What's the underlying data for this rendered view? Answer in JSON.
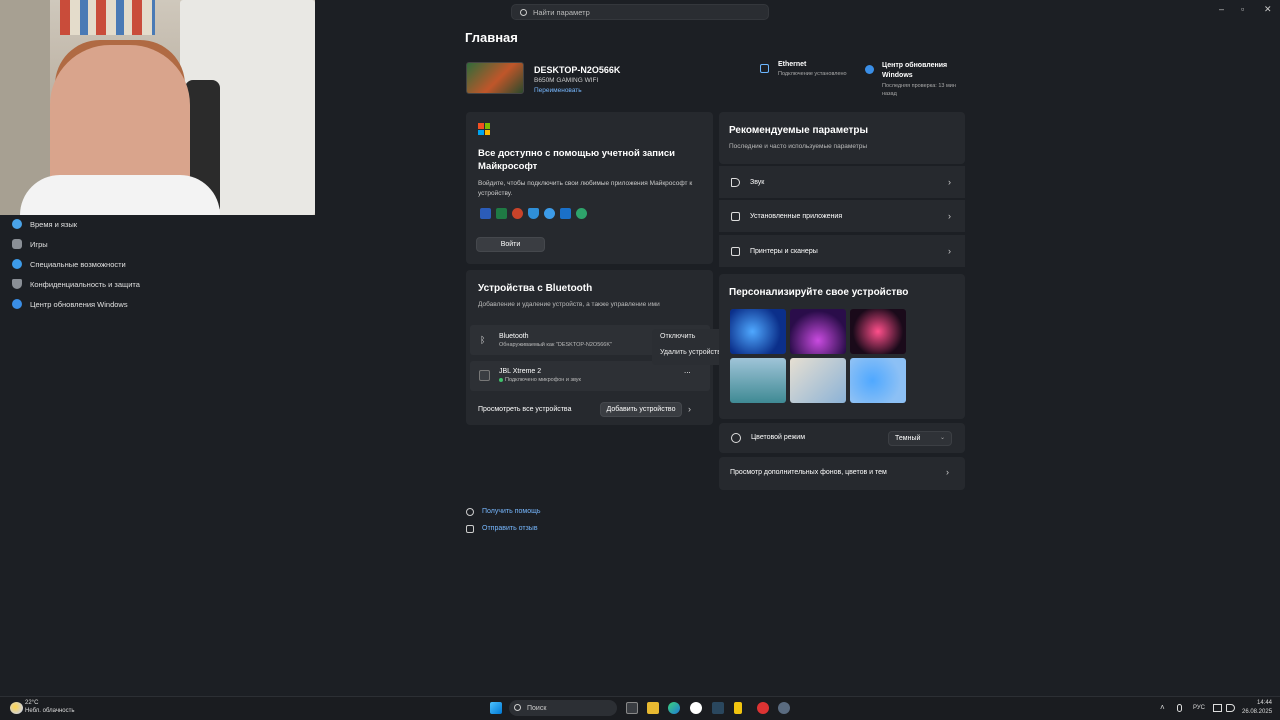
{
  "search": {
    "placeholder": "Найти параметр"
  },
  "page": {
    "title": "Главная"
  },
  "device": {
    "name": "DESKTOP-N2O566K",
    "model": "B650M GAMING WIFI",
    "rename": "Переименовать"
  },
  "status": {
    "ethernet_title": "Ethernet",
    "ethernet_sub": "Подключение установлено",
    "update_title": "Центр обновления Windows",
    "update_sub": "Последняя проверка: 13 мин назад"
  },
  "sidebar": {
    "items": [
      {
        "label": "Время и язык",
        "icon": "globe-clock-icon",
        "color": "#4aa3e8"
      },
      {
        "label": "Игры",
        "icon": "gamepad-icon",
        "color": "#8a8f96"
      },
      {
        "label": "Специальные возможности",
        "icon": "accessibility-icon",
        "color": "#3d9be9"
      },
      {
        "label": "Конфиденциальность и защита",
        "icon": "shield-icon",
        "color": "#8a8f96"
      },
      {
        "label": "Центр обновления Windows",
        "icon": "update-icon",
        "color": "#3a8ee6"
      }
    ]
  },
  "ms_card": {
    "title": "Все доступно с помощью учетной записи Майкрософт",
    "desc": "Войдите, чтобы подключить свои любимые приложения Майкрософт к устройству.",
    "button": "Войти"
  },
  "bt_card": {
    "title": "Устройства с Bluetooth",
    "subtitle": "Добавление и удаление устройств, а также управление ими",
    "bt_name": "Bluetooth",
    "bt_sub": "Обнаруживаемый как \"DESKTOP-N2O566K\"",
    "dev_name": "JBL Xtreme 2",
    "dev_sub": "Подключено микрофон и звук",
    "view_all": "Просмотреть все устройства",
    "add": "Добавить устройство",
    "more_dots": "..."
  },
  "context_menu": {
    "disconnect": "Отключить",
    "remove": "Удалить устройство"
  },
  "recommended": {
    "title": "Рекомендуемые параметры",
    "subtitle": "Последние и часто используемые параметры",
    "items": [
      "Звук",
      "Установленные приложения",
      "Принтеры и сканеры"
    ]
  },
  "personalize": {
    "title": "Персонализируйте свое устройство",
    "mode_label": "Цветовой режим",
    "mode_value": "Темный",
    "more": "Просмотр дополнительных фонов, цветов и тем"
  },
  "help": {
    "get_help": "Получить помощь",
    "feedback": "Отправить отзыв"
  },
  "taskbar": {
    "weather_temp": "22°C",
    "weather_desc": "Небл. облачность",
    "search": "Поиск",
    "lang": "РУС",
    "time": "14:44",
    "date": "26.08.2025"
  },
  "colors": {
    "accent": "#77b8ff",
    "bg": "#1c1f24",
    "card": "#26292e"
  }
}
